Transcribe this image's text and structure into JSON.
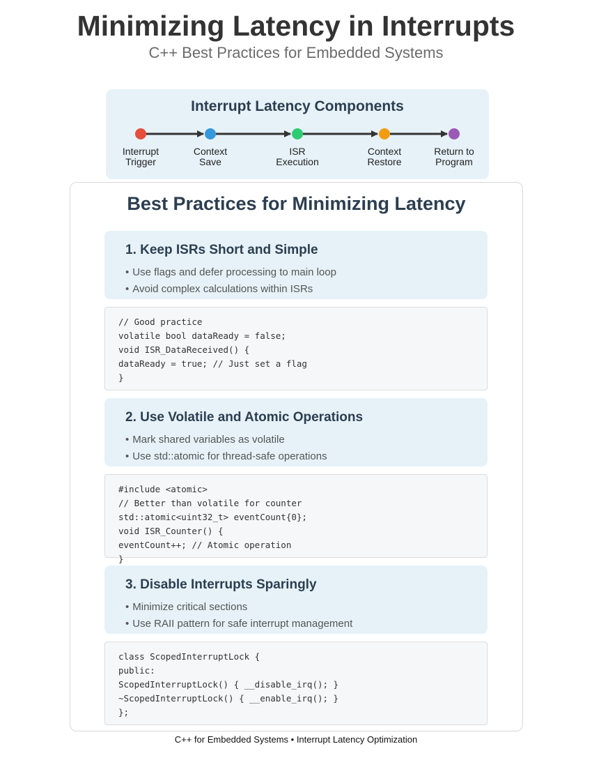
{
  "header": {
    "title": "Minimizing Latency in Interrupts",
    "subtitle": "C++ Best Practices for Embedded Systems"
  },
  "timeline": {
    "title": "Interrupt Latency Components",
    "steps": [
      {
        "line1": "Interrupt",
        "line2": "Trigger",
        "color": "#e74c3c"
      },
      {
        "line1": "Context",
        "line2": "Save",
        "color": "#3498db"
      },
      {
        "line1": "ISR",
        "line2": "Execution",
        "color": "#2ecc71"
      },
      {
        "line1": "Context",
        "line2": "Restore",
        "color": "#f39c12"
      },
      {
        "line1": "Return to",
        "line2": "Program",
        "color": "#9b59b6"
      }
    ]
  },
  "main": {
    "title": "Best Practices for Minimizing Latency",
    "practices": [
      {
        "heading": "1. Keep ISRs Short and Simple",
        "bullets": [
          "Use flags and defer processing to main loop",
          "Avoid complex calculations within ISRs"
        ],
        "code": [
          "// Good practice",
          "volatile bool dataReady = false;",
          "void ISR_DataReceived() {",
          "dataReady = true; // Just set a flag",
          "}"
        ]
      },
      {
        "heading": "2. Use Volatile and Atomic Operations",
        "bullets": [
          "Mark shared variables as volatile",
          "Use std::atomic for thread-safe operations"
        ],
        "code": [
          "#include <atomic>",
          "// Better than volatile for counter",
          "std::atomic<uint32_t> eventCount{0};",
          "void ISR_Counter() {",
          "eventCount++; // Atomic operation",
          "}"
        ]
      },
      {
        "heading": "3. Disable Interrupts Sparingly",
        "bullets": [
          "Minimize critical sections",
          "Use RAII pattern for safe interrupt management"
        ],
        "code": [
          "class ScopedInterruptLock {",
          "public:",
          "ScopedInterruptLock() { __disable_irq(); }",
          "~ScopedInterruptLock() { __enable_irq(); }",
          "};"
        ]
      }
    ]
  },
  "footer": {
    "text": "C++ for Embedded Systems • Interrupt Latency Optimization"
  },
  "colors": {
    "panel_bg": "#e6f2f8",
    "heading": "#2c3e50",
    "code_bg": "#f6f7f8",
    "arrow": "#333333"
  }
}
